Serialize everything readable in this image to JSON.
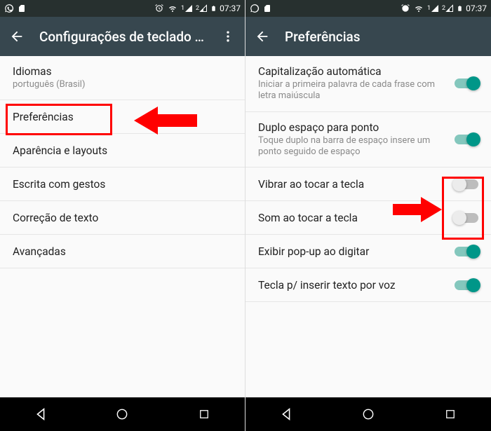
{
  "status": {
    "time": "07:37",
    "sim1_label": "1",
    "sim2_label": "2"
  },
  "left": {
    "title": "Configurações de teclado d…",
    "items": [
      {
        "primary": "Idiomas",
        "secondary": "português (Brasil)"
      },
      {
        "primary": "Preferências"
      },
      {
        "primary": "Aparência e layouts"
      },
      {
        "primary": "Escrita com gestos"
      },
      {
        "primary": "Correção de texto"
      },
      {
        "primary": "Avançadas"
      }
    ]
  },
  "right": {
    "title": "Preferências",
    "items": [
      {
        "primary": "Capitalização automática",
        "secondary": "Iniciar a primeira palavra de cada frase com letra maiúscula",
        "toggle": "on"
      },
      {
        "primary": "Duplo espaço para ponto",
        "secondary": "Toque duplo na barra de espaço insere um ponto seguido de espaço",
        "toggle": "on"
      },
      {
        "primary": "Vibrar ao tocar a tecla",
        "toggle": "off"
      },
      {
        "primary": "Som ao tocar a tecla",
        "toggle": "off"
      },
      {
        "primary": "Exibir pop-up ao digitar",
        "toggle": "on"
      },
      {
        "primary": "Tecla p/ inserir texto por voz",
        "toggle": "on"
      }
    ]
  }
}
